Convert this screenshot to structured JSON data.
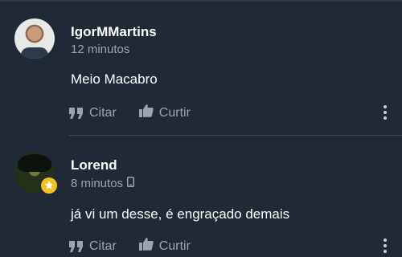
{
  "comments": [
    {
      "username": "IgorMMartins",
      "time": "12 minutos",
      "text": "Meio Macabro",
      "quote_label": "Citar",
      "like_label": "Curtir"
    },
    {
      "username": "Lorend",
      "time": "8 minutos",
      "text": "já vi um desse, é engraçado demais",
      "quote_label": "Citar",
      "like_label": "Curtir"
    }
  ],
  "colors": {
    "background": "#1f2a36",
    "text": "#ffffff",
    "muted": "#9aa4af",
    "badge": "#f1c21b"
  }
}
